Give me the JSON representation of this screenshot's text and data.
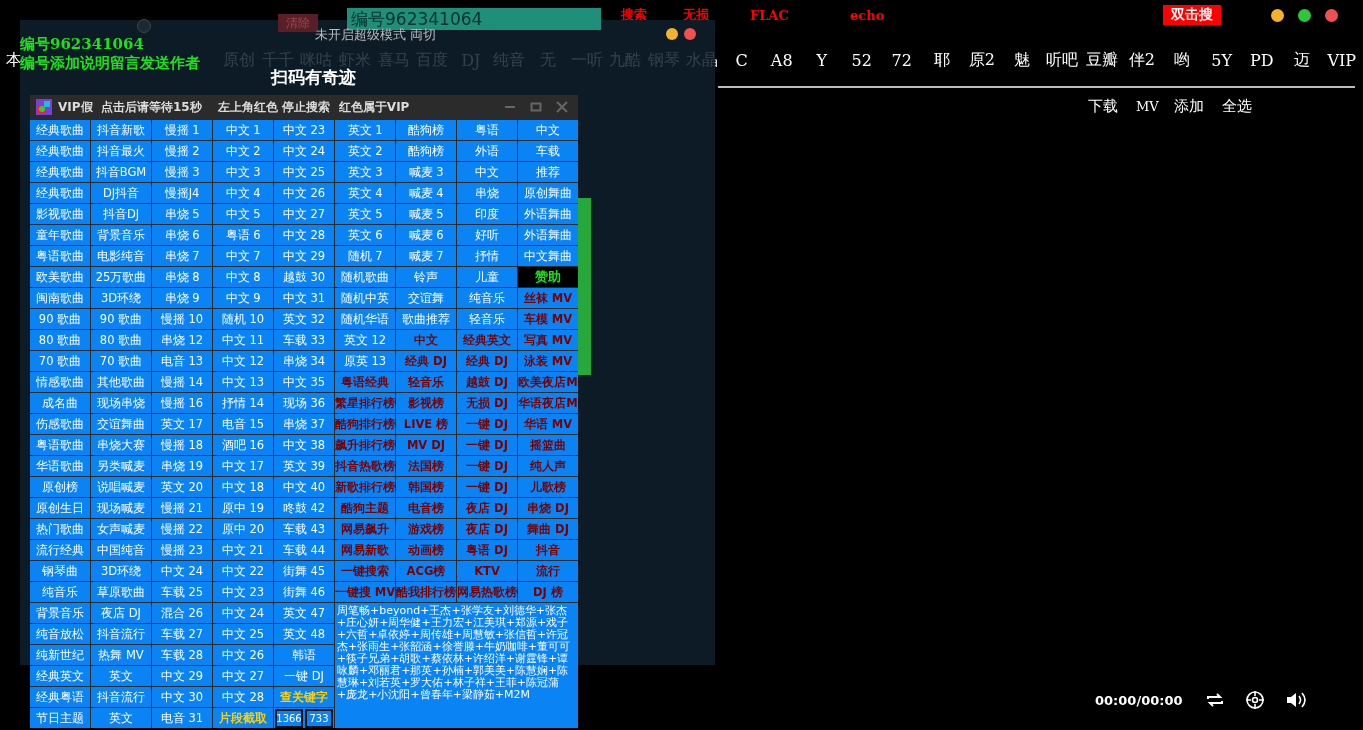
{
  "top_bar": {
    "actions": [
      "搜索",
      "无损",
      "FLAC",
      "echo"
    ],
    "search_button": "双击搜"
  },
  "sources": [
    "本",
    "原创",
    "千千",
    "咪咕",
    "虾米",
    "喜马",
    "百度",
    "DJ",
    "纯音",
    "无",
    "一听",
    "九酷",
    "钢琴",
    "水晶",
    "C",
    "A8",
    "Y",
    "52",
    "72",
    "耶",
    "原2",
    "魅",
    "听吧",
    "豆瓣",
    "伴2",
    "哟",
    "5Y",
    "PD",
    "迈",
    "VIP"
  ],
  "list_actions": [
    "下载",
    "MV",
    "添加",
    "全选"
  ],
  "player": {
    "time": "00:00/00:00"
  },
  "overlay": {
    "title": "未开启超级模式 両切",
    "clear_button": "清除",
    "id_bar": "编号962341064",
    "notes": [
      "编号962341064",
      "编号添加说明留言发送作者"
    ],
    "slogan": "扫码有奇迹"
  },
  "vip_window": {
    "title": "VIP假  点击后请等待15秒    左上角红色 停止搜索  红色属于VIP",
    "columns": [
      [
        {
          "text": "经典歌曲",
          "kind": "plain"
        },
        {
          "text": "经典歌曲",
          "kind": "plain"
        },
        {
          "text": "经典歌曲",
          "kind": "plain"
        },
        {
          "text": "经典歌曲",
          "kind": "plain"
        },
        {
          "text": "影视歌曲",
          "kind": "plain"
        },
        {
          "text": "童年歌曲",
          "kind": "plain"
        },
        {
          "text": "粤语歌曲",
          "kind": "plain"
        },
        {
          "text": "欧美歌曲",
          "kind": "plain"
        },
        {
          "text": "闽南歌曲",
          "kind": "plain"
        },
        {
          "text": "90 歌曲",
          "kind": "plain"
        },
        {
          "text": "80 歌曲",
          "kind": "plain"
        },
        {
          "text": "70 歌曲",
          "kind": "plain"
        },
        {
          "text": "情感歌曲",
          "kind": "plain"
        },
        {
          "text": "成名曲",
          "kind": "plain"
        },
        {
          "text": "伤感歌曲",
          "kind": "plain"
        },
        {
          "text": "粤语歌曲",
          "kind": "plain"
        },
        {
          "text": "华语歌曲",
          "kind": "plain"
        },
        {
          "text": "原创榜",
          "kind": "plain"
        },
        {
          "text": "原创生日",
          "kind": "plain"
        },
        {
          "text": "热门歌曲",
          "kind": "plain"
        },
        {
          "text": "流行经典",
          "kind": "plain"
        },
        {
          "text": "钢琴曲",
          "kind": "plain"
        },
        {
          "text": "纯音乐",
          "kind": "plain"
        },
        {
          "text": "背景音乐",
          "kind": "plain"
        },
        {
          "text": "纯音放松",
          "kind": "plain"
        },
        {
          "text": "纯新世纪",
          "kind": "plain"
        },
        {
          "text": "经典英文",
          "kind": "plain"
        },
        {
          "text": "经典粤语",
          "kind": "plain"
        },
        {
          "text": "节日主题",
          "kind": "plain"
        }
      ],
      [
        {
          "text": "抖音新歌",
          "kind": "plain"
        },
        {
          "text": "抖音最火",
          "kind": "plain"
        },
        {
          "text": "抖音BGM",
          "kind": "plain"
        },
        {
          "text": "DJ抖音",
          "kind": "plain"
        },
        {
          "text": "抖音DJ",
          "kind": "plain"
        },
        {
          "text": "背景音乐",
          "kind": "plain"
        },
        {
          "text": "电影纯音",
          "kind": "plain"
        },
        {
          "text": "25万歌曲",
          "kind": "plain"
        },
        {
          "text": "3D环绕",
          "kind": "plain"
        },
        {
          "text": "90 歌曲",
          "kind": "plain"
        },
        {
          "text": "80 歌曲",
          "kind": "plain"
        },
        {
          "text": "70 歌曲",
          "kind": "plain"
        },
        {
          "text": "其他歌曲",
          "kind": "plain"
        },
        {
          "text": "现场串烧",
          "kind": "plain"
        },
        {
          "text": "交谊舞曲",
          "kind": "plain"
        },
        {
          "text": "串烧大赛",
          "kind": "plain"
        },
        {
          "text": "另类喊麦",
          "kind": "plain"
        },
        {
          "text": "说唱喊麦",
          "kind": "plain"
        },
        {
          "text": "现场喊麦",
          "kind": "plain"
        },
        {
          "text": "女声喊麦",
          "kind": "plain"
        },
        {
          "text": "中国纯音",
          "kind": "plain"
        },
        {
          "text": "3D环绕",
          "kind": "plain"
        },
        {
          "text": "草原歌曲",
          "kind": "plain"
        },
        {
          "text": "夜店 DJ",
          "kind": "plain"
        },
        {
          "text": "抖音流行",
          "kind": "plain"
        },
        {
          "text": "热舞 MV",
          "kind": "plain"
        },
        {
          "text": "英文",
          "kind": "plain"
        },
        {
          "text": "抖音流行",
          "kind": "plain"
        },
        {
          "text": "英文",
          "kind": "plain"
        }
      ],
      [
        {
          "text": "慢摇 1",
          "kind": "plain"
        },
        {
          "text": "慢摇 2",
          "kind": "plain"
        },
        {
          "text": "慢摇 3",
          "kind": "plain"
        },
        {
          "text": "慢摇J4",
          "kind": "plain"
        },
        {
          "text": "串烧 5",
          "kind": "plain"
        },
        {
          "text": "串烧 6",
          "kind": "plain"
        },
        {
          "text": "串烧 7",
          "kind": "plain"
        },
        {
          "text": "串烧 8",
          "kind": "plain"
        },
        {
          "text": "串烧 9",
          "kind": "plain"
        },
        {
          "text": "慢摇 10",
          "kind": "plain"
        },
        {
          "text": "串烧 12",
          "kind": "plain"
        },
        {
          "text": "电音 13",
          "kind": "plain"
        },
        {
          "text": "慢摇 14",
          "kind": "plain"
        },
        {
          "text": "慢摇 16",
          "kind": "plain"
        },
        {
          "text": "英文 17",
          "kind": "plain"
        },
        {
          "text": "慢摇 18",
          "kind": "plain"
        },
        {
          "text": "串烧 19",
          "kind": "plain"
        },
        {
          "text": "英文 20",
          "kind": "plain"
        },
        {
          "text": "慢摇 21",
          "kind": "plain"
        },
        {
          "text": "慢摇 22",
          "kind": "plain"
        },
        {
          "text": "慢摇 23",
          "kind": "plain"
        },
        {
          "text": "中文 24",
          "kind": "plain"
        },
        {
          "text": "车载 25",
          "kind": "plain"
        },
        {
          "text": "混合 26",
          "kind": "plain"
        },
        {
          "text": "车载 27",
          "kind": "plain"
        },
        {
          "text": "车载 28",
          "kind": "plain"
        },
        {
          "text": "中文 29",
          "kind": "plain"
        },
        {
          "text": "中文 30",
          "kind": "plain"
        },
        {
          "text": "电音 31",
          "kind": "plain"
        }
      ],
      [
        {
          "text": "中文 1",
          "kind": "plain"
        },
        {
          "text": "中文 2",
          "kind": "plain"
        },
        {
          "text": "中文 3",
          "kind": "plain"
        },
        {
          "text": "中文 4",
          "kind": "plain"
        },
        {
          "text": "中文 5",
          "kind": "plain"
        },
        {
          "text": "粤语 6",
          "kind": "plain"
        },
        {
          "text": "中文 7",
          "kind": "plain"
        },
        {
          "text": "中文 8",
          "kind": "plain"
        },
        {
          "text": "中文 9",
          "kind": "plain"
        },
        {
          "text": "随机 10",
          "kind": "plain"
        },
        {
          "text": "中文 11",
          "kind": "plain"
        },
        {
          "text": "中文 12",
          "kind": "plain"
        },
        {
          "text": "中文 13",
          "kind": "plain"
        },
        {
          "text": "抒情 14",
          "kind": "plain"
        },
        {
          "text": "电音 15",
          "kind": "plain"
        },
        {
          "text": "酒吧 16",
          "kind": "plain"
        },
        {
          "text": "中文 17",
          "kind": "plain"
        },
        {
          "text": "中文 18",
          "kind": "plain"
        },
        {
          "text": "原中 19",
          "kind": "plain"
        },
        {
          "text": "原中 20",
          "kind": "plain"
        },
        {
          "text": "中文 21",
          "kind": "plain"
        },
        {
          "text": "中文 22",
          "kind": "plain"
        },
        {
          "text": "中文 23",
          "kind": "plain"
        },
        {
          "text": "中文 24",
          "kind": "plain"
        },
        {
          "text": "中文 25",
          "kind": "plain"
        },
        {
          "text": "中文 26",
          "kind": "plain"
        },
        {
          "text": "中文 27",
          "kind": "plain"
        },
        {
          "text": "中文 28",
          "kind": "plain"
        },
        {
          "text": "片段截取",
          "kind": "tool"
        }
      ],
      [
        {
          "text": "中文 23",
          "kind": "plain"
        },
        {
          "text": "中文 24",
          "kind": "plain"
        },
        {
          "text": "中文 25",
          "kind": "plain"
        },
        {
          "text": "中文 26",
          "kind": "plain"
        },
        {
          "text": "中文 27",
          "kind": "plain"
        },
        {
          "text": "中文 28",
          "kind": "plain"
        },
        {
          "text": "中文 29",
          "kind": "plain"
        },
        {
          "text": "越鼓 30",
          "kind": "plain"
        },
        {
          "text": "中文 31",
          "kind": "plain"
        },
        {
          "text": "英文 32",
          "kind": "plain"
        },
        {
          "text": "车载 33",
          "kind": "plain"
        },
        {
          "text": "串烧 34",
          "kind": "plain"
        },
        {
          "text": "中文 35",
          "kind": "plain"
        },
        {
          "text": "现场 36",
          "kind": "plain"
        },
        {
          "text": "串烧 37",
          "kind": "plain"
        },
        {
          "text": "中文 38",
          "kind": "plain"
        },
        {
          "text": "英文 39",
          "kind": "plain"
        },
        {
          "text": "中文 40",
          "kind": "plain"
        },
        {
          "text": "咚鼓 42",
          "kind": "plain"
        },
        {
          "text": "车载 43",
          "kind": "plain"
        },
        {
          "text": "车载 44",
          "kind": "plain"
        },
        {
          "text": "街舞 45",
          "kind": "plain"
        },
        {
          "text": "街舞 46",
          "kind": "plain"
        },
        {
          "text": "英文 47",
          "kind": "plain"
        },
        {
          "text": "英文 48",
          "kind": "plain"
        },
        {
          "text": "韩语",
          "kind": "plain"
        },
        {
          "text": "一键 DJ",
          "kind": "plain"
        },
        {
          "text": "查关键字",
          "kind": "tool"
        }
      ],
      [
        {
          "text": "英文 1",
          "kind": "plain"
        },
        {
          "text": "英文 2",
          "kind": "plain"
        },
        {
          "text": "英文 3",
          "kind": "plain"
        },
        {
          "text": "英文 4",
          "kind": "plain"
        },
        {
          "text": "英文 5",
          "kind": "plain"
        },
        {
          "text": "英文 6",
          "kind": "plain"
        },
        {
          "text": "随机 7",
          "kind": "plain"
        },
        {
          "text": "随机歌曲",
          "kind": "plain"
        },
        {
          "text": "随机中英",
          "kind": "plain"
        },
        {
          "text": "随机华语",
          "kind": "plain"
        },
        {
          "text": "英文 12",
          "kind": "plain"
        },
        {
          "text": "原英 13",
          "kind": "plain"
        },
        {
          "text": "粤语经典",
          "kind": "vip"
        },
        {
          "text": "繁星排行榜",
          "kind": "vip"
        },
        {
          "text": "酷狗排行榜",
          "kind": "vip"
        },
        {
          "text": "飙升排行榜",
          "kind": "vip"
        },
        {
          "text": "抖音热歌榜",
          "kind": "vip"
        },
        {
          "text": "新歌排行榜",
          "kind": "vip"
        },
        {
          "text": "酷狗主题",
          "kind": "vip"
        },
        {
          "text": "网易飙升",
          "kind": "vip"
        },
        {
          "text": "网易新歌",
          "kind": "vip"
        },
        {
          "text": "一键搜索",
          "kind": "vip"
        },
        {
          "text": "一键搜 MV",
          "kind": "vip"
        }
      ],
      [
        {
          "text": "酷狗榜",
          "kind": "plain"
        },
        {
          "text": "酷狗榜",
          "kind": "plain"
        },
        {
          "text": "喊麦 3",
          "kind": "plain"
        },
        {
          "text": "喊麦 4",
          "kind": "plain"
        },
        {
          "text": "喊麦 5",
          "kind": "plain"
        },
        {
          "text": "喊麦 6",
          "kind": "plain"
        },
        {
          "text": "喊麦 7",
          "kind": "plain"
        },
        {
          "text": "铃声",
          "kind": "plain"
        },
        {
          "text": "交谊舞",
          "kind": "plain"
        },
        {
          "text": "歌曲推荐",
          "kind": "plain"
        },
        {
          "text": "中文",
          "kind": "vip"
        },
        {
          "text": "经典 DJ",
          "kind": "vip"
        },
        {
          "text": "轻音乐",
          "kind": "vip"
        },
        {
          "text": "影视榜",
          "kind": "vip"
        },
        {
          "text": "LIVE 榜",
          "kind": "vip"
        },
        {
          "text": "MV DJ",
          "kind": "vip"
        },
        {
          "text": "法国榜",
          "kind": "vip"
        },
        {
          "text": "韩国榜",
          "kind": "vip"
        },
        {
          "text": "电音榜",
          "kind": "vip"
        },
        {
          "text": "游戏榜",
          "kind": "vip"
        },
        {
          "text": "动画榜",
          "kind": "vip"
        },
        {
          "text": "ACG榜",
          "kind": "vip"
        },
        {
          "text": "酷我排行榜",
          "kind": "vip"
        }
      ],
      [
        {
          "text": "粤语",
          "kind": "plain"
        },
        {
          "text": "外语",
          "kind": "plain"
        },
        {
          "text": "中文",
          "kind": "plain"
        },
        {
          "text": "串烧",
          "kind": "plain"
        },
        {
          "text": "印度",
          "kind": "plain"
        },
        {
          "text": "好听",
          "kind": "plain"
        },
        {
          "text": "抒情",
          "kind": "plain"
        },
        {
          "text": "儿童",
          "kind": "plain"
        },
        {
          "text": "纯音乐",
          "kind": "plain"
        },
        {
          "text": "轻音乐",
          "kind": "plain"
        },
        {
          "text": "经典英文",
          "kind": "vip"
        },
        {
          "text": "经典 DJ",
          "kind": "vip"
        },
        {
          "text": "越鼓 DJ",
          "kind": "vip"
        },
        {
          "text": "无损 DJ",
          "kind": "vip"
        },
        {
          "text": "一键 DJ",
          "kind": "vip"
        },
        {
          "text": "一键 DJ",
          "kind": "vip"
        },
        {
          "text": "一键 DJ",
          "kind": "vip"
        },
        {
          "text": "一键 DJ",
          "kind": "vip"
        },
        {
          "text": "夜店 DJ",
          "kind": "vip"
        },
        {
          "text": "夜店 DJ",
          "kind": "vip"
        },
        {
          "text": "粤语 DJ",
          "kind": "vip"
        },
        {
          "text": "KTV",
          "kind": "vip"
        },
        {
          "text": "网易热歌榜",
          "kind": "vip"
        }
      ],
      [
        {
          "text": "中文",
          "kind": "plain"
        },
        {
          "text": "车载",
          "kind": "plain"
        },
        {
          "text": "推荐",
          "kind": "plain"
        },
        {
          "text": "原创舞曲",
          "kind": "plain"
        },
        {
          "text": "外语舞曲",
          "kind": "plain"
        },
        {
          "text": "外语舞曲",
          "kind": "plain"
        },
        {
          "text": "中文舞曲",
          "kind": "plain"
        },
        {
          "text": "赞助",
          "kind": "sponsor"
        },
        {
          "text": "丝袜 MV",
          "kind": "vip"
        },
        {
          "text": "车模 MV",
          "kind": "vip"
        },
        {
          "text": "写真 MV",
          "kind": "vip"
        },
        {
          "text": "泳装 MV",
          "kind": "vip"
        },
        {
          "text": "欧美夜店M",
          "kind": "vip"
        },
        {
          "text": "华语夜店M",
          "kind": "vip"
        },
        {
          "text": "华语 MV",
          "kind": "vip"
        },
        {
          "text": "摇篮曲",
          "kind": "vip"
        },
        {
          "text": "纯人声",
          "kind": "vip"
        },
        {
          "text": "儿歌榜",
          "kind": "vip"
        },
        {
          "text": "串烧 DJ",
          "kind": "vip"
        },
        {
          "text": "舞曲 DJ",
          "kind": "vip"
        },
        {
          "text": "抖音",
          "kind": "vip"
        },
        {
          "text": "流行",
          "kind": "vip"
        },
        {
          "text": "DJ 榜",
          "kind": "vip"
        }
      ]
    ],
    "size_fields": [
      "1366",
      "733"
    ],
    "artists": "周笔畅+beyond+王杰+张学友+刘德华+张杰+庄心妍+周华健+王力宏+江美琪+郑源+戏子+六哲+卓依婷+周传雄+周慧敏+张信哲+许冠杰+张雨生+张韶涵+徐誉滕+牛奶咖啡+董可可+筷子兄弟+胡歌+蔡依林+许绍洋+谢霆锋+谭咏麟+邓丽君+那英+孙楠+郭美美+陈慧娴+陈慧琳+刘若英+罗大佑+林子祥+王菲+陈冠蒲+庞龙+小沈阳+曾春年+梁静茹+M2M"
  }
}
